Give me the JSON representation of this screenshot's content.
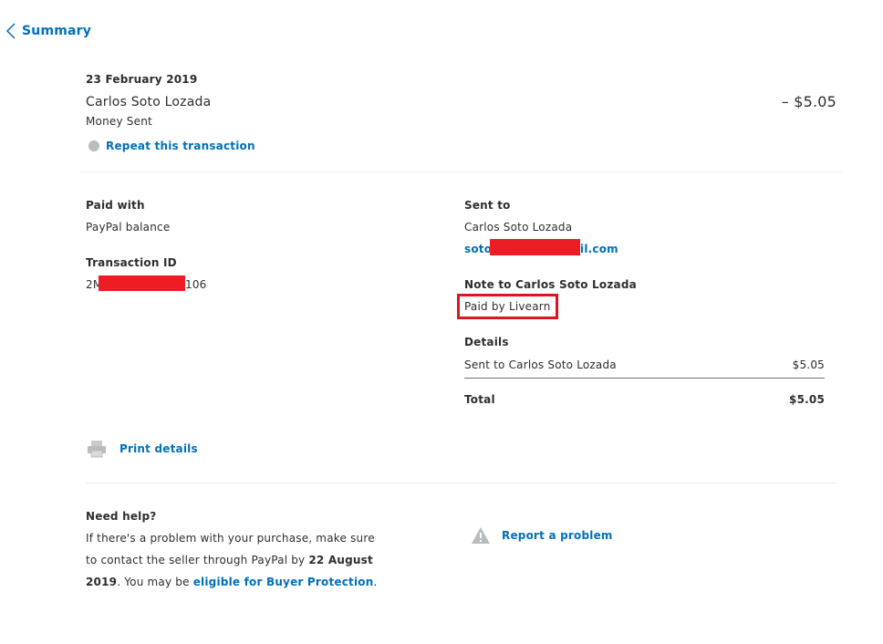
{
  "header": {
    "back_label": "Summary"
  },
  "transaction": {
    "date": "23 February 2019",
    "name": "Carlos Soto Lozada",
    "type": "Money Sent",
    "amount": "– $5.05",
    "repeat_label": "Repeat this transaction"
  },
  "paid_with": {
    "label": "Paid with",
    "value": "PayPal balance"
  },
  "transaction_id": {
    "label": "Transaction ID",
    "prefix": "2M",
    "suffix": "106"
  },
  "sent_to": {
    "label": "Sent to",
    "name": "Carlos Soto Lozada",
    "email_prefix": "soto",
    "email_suffix": "il.com"
  },
  "note": {
    "label": "Note to Carlos Soto Lozada",
    "value": "Paid by Livearn"
  },
  "details": {
    "label": "Details",
    "line_label": "Sent to Carlos Soto Lozada",
    "line_amount": "$5.05",
    "total_label": "Total",
    "total_amount": "$5.05"
  },
  "print_label": "Print details",
  "help": {
    "title": "Need help?",
    "line1": "If there's a problem with your purchase, make sure",
    "line2a": "to contact the seller through PayPal by ",
    "line2b": "22 August",
    "line3a": "2019",
    "line3b": ". You may be ",
    "line3c": "eligible for Buyer Protection",
    "line3d": "."
  },
  "report_label": "Report a problem",
  "colors": {
    "link": "#0070ba",
    "redaction": "#ee1c25",
    "highlight_box": "#e0141e"
  },
  "icons": [
    "chevron-left-icon",
    "repeat-circle-icon",
    "printer-icon",
    "warning-icon"
  ]
}
